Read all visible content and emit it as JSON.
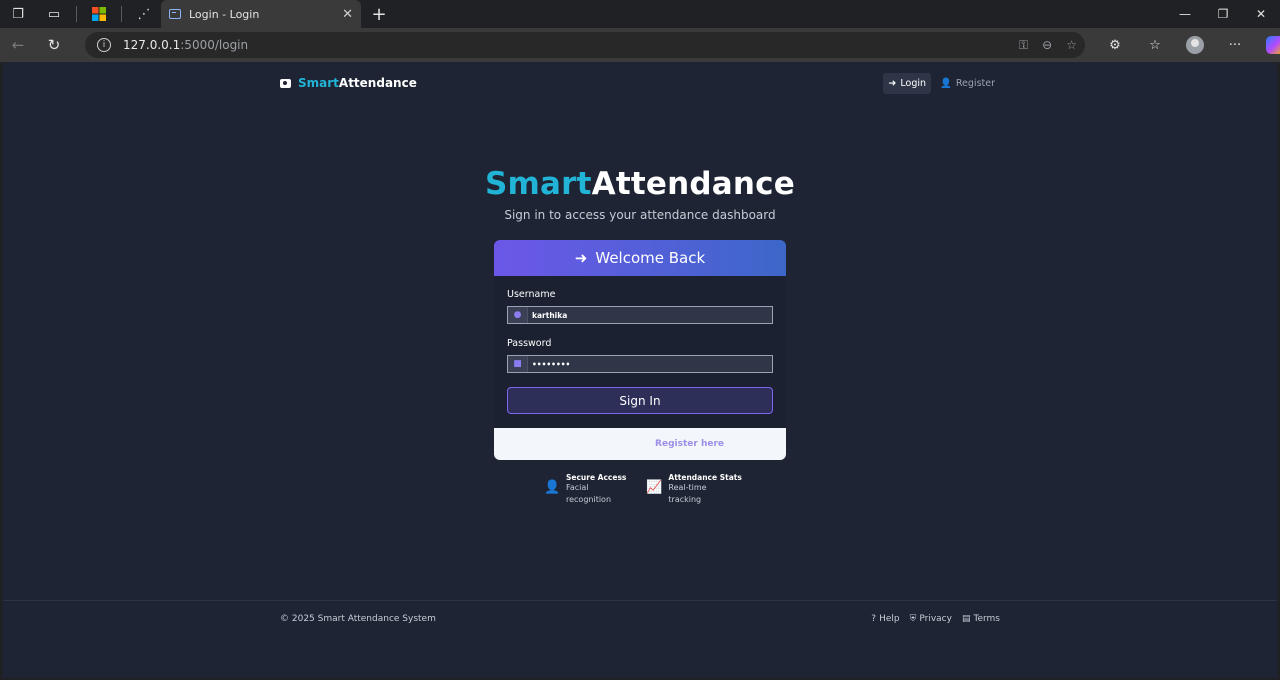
{
  "browser": {
    "tab_title": "Login - Login",
    "tab_close": "✕",
    "new_tab": "+",
    "url_host": "127.0.0.1",
    "url_path": ":5000/login"
  },
  "nav": {
    "brand_accent": "Smart",
    "brand_rest": "Attendance",
    "login": "Login",
    "register": "Register"
  },
  "hero": {
    "title_accent": "Smart",
    "title_rest": "Attendance",
    "subtitle": "Sign in to access your attendance dashboard"
  },
  "login_card": {
    "header": "Welcome Back",
    "username_label": "Username",
    "username_value": "karthika",
    "password_label": "Password",
    "password_value": "••••••••",
    "signin_label": "Sign In",
    "register_link": "Register here"
  },
  "features": [
    {
      "title": "Secure Access",
      "desc": "Facial recognition",
      "icon": "user-shield-icon"
    },
    {
      "title": "Attendance Stats",
      "desc": "Real-time tracking",
      "icon": "chart-line-icon"
    }
  ],
  "footer": {
    "copyright": "© 2025 Smart Attendance System",
    "help": "Help",
    "privacy": "Privacy",
    "terms": "Terms"
  },
  "colors": {
    "accent": "#22b4d6",
    "page_bg": "#1e2433",
    "header_gradient_start": "#6c57e8",
    "header_gradient_end": "#3d67c9"
  }
}
